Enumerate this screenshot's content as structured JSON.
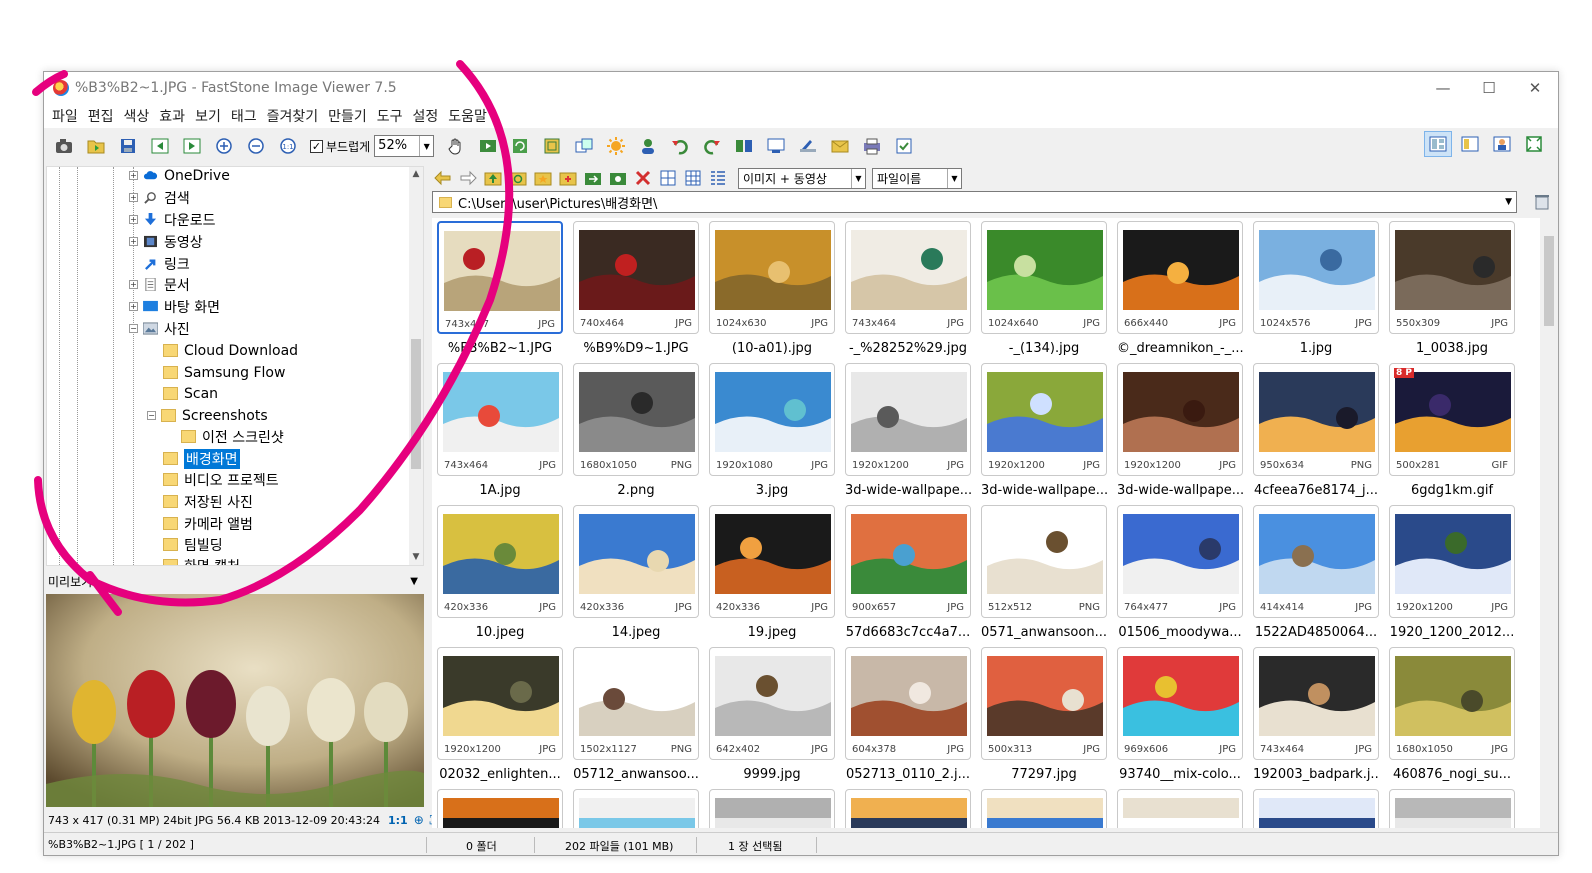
{
  "window": {
    "title": "%B3%B2~1.JPG  -  FastStone Image Viewer 7.5",
    "controls": {
      "minimize": "—",
      "maximize": "☐",
      "close": "✕"
    }
  },
  "menu": [
    "파일",
    "편집",
    "색상",
    "효과",
    "보기",
    "태그",
    "즐겨찾기",
    "만들기",
    "도구",
    "설정",
    "도움말"
  ],
  "toolbar": {
    "smooth_label": "부드럽게",
    "smooth_checked": true,
    "zoom": "52%"
  },
  "tree": {
    "items": [
      {
        "label": "OneDrive",
        "icon": "cloud-icon"
      },
      {
        "label": "검색",
        "icon": "search-icon"
      },
      {
        "label": "다운로드",
        "icon": "download-icon"
      },
      {
        "label": "동영상",
        "icon": "video-icon"
      },
      {
        "label": "링크",
        "icon": "link-icon"
      },
      {
        "label": "문서",
        "icon": "document-icon"
      },
      {
        "label": "바탕 화면",
        "icon": "desktop-icon"
      },
      {
        "label": "사진",
        "icon": "pictures-icon"
      },
      {
        "label": "Cloud Download",
        "icon": "folder-icon"
      },
      {
        "label": "Samsung Flow",
        "icon": "folder-icon"
      },
      {
        "label": "Scan",
        "icon": "folder-icon"
      },
      {
        "label": "Screenshots",
        "icon": "folder-icon"
      },
      {
        "label": "이전 스크린샷",
        "icon": "folder-icon"
      },
      {
        "label": "배경화면",
        "icon": "folder-icon",
        "selected": true
      },
      {
        "label": "비디오 프로젝트",
        "icon": "folder-icon"
      },
      {
        "label": "저장된 사진",
        "icon": "folder-icon"
      },
      {
        "label": "카메라 앨범",
        "icon": "folder-icon"
      },
      {
        "label": "팀빌딩",
        "icon": "folder-icon"
      },
      {
        "label": "화면 캡처",
        "icon": "folder-icon"
      }
    ]
  },
  "preview": {
    "title": "미리보기",
    "info": "743 x 417 (0.31 MP)  24bit  JPG   56.4 KB   2013-12-09 20:43:24",
    "ratio": "1:1"
  },
  "browser": {
    "filter": "이미지 + 동영상",
    "sort": "파일이름",
    "path": "C:\\Users\\user\\Pictures\\배경화면\\",
    "thumbnails": [
      {
        "name": "%B3%B2~1.JPG",
        "dims": "743x417",
        "ext": "JPG",
        "selected": true
      },
      {
        "name": "%B9%D9~1.JPG",
        "dims": "740x464",
        "ext": "JPG"
      },
      {
        "name": "(10-a01).jpg",
        "dims": "1024x630",
        "ext": "JPG"
      },
      {
        "name": "-_%28252%29.jpg",
        "dims": "743x464",
        "ext": "JPG"
      },
      {
        "name": "-_(134).jpg",
        "dims": "1024x640",
        "ext": "JPG"
      },
      {
        "name": "©_dreamnikon_-_...",
        "dims": "666x440",
        "ext": "JPG"
      },
      {
        "name": "1.jpg",
        "dims": "1024x576",
        "ext": "JPG"
      },
      {
        "name": "1_0038.jpg",
        "dims": "550x309",
        "ext": "JPG"
      },
      {
        "name": "1A.jpg",
        "dims": "743x464",
        "ext": "JPG"
      },
      {
        "name": "2.png",
        "dims": "1680x1050",
        "ext": "PNG"
      },
      {
        "name": "3.jpg",
        "dims": "1920x1080",
        "ext": "JPG"
      },
      {
        "name": "3d-wide-wallpape...",
        "dims": "1920x1200",
        "ext": "JPG"
      },
      {
        "name": "3d-wide-wallpape...",
        "dims": "1920x1200",
        "ext": "JPG"
      },
      {
        "name": "3d-wide-wallpape...",
        "dims": "1920x1200",
        "ext": "JPG"
      },
      {
        "name": "4cfeea76e8174_j...",
        "dims": "950x634",
        "ext": "PNG"
      },
      {
        "name": "6gdg1km.gif",
        "dims": "500x281",
        "ext": "GIF",
        "badge": "8 P"
      },
      {
        "name": "10.jpeg",
        "dims": "420x336",
        "ext": "JPG"
      },
      {
        "name": "14.jpeg",
        "dims": "420x336",
        "ext": "JPG"
      },
      {
        "name": "19.jpeg",
        "dims": "420x336",
        "ext": "JPG"
      },
      {
        "name": "57d6683c7cc4a7...",
        "dims": "900x657",
        "ext": "JPG"
      },
      {
        "name": "0571_anwansoon...",
        "dims": "512x512",
        "ext": "PNG"
      },
      {
        "name": "01506_moodywa...",
        "dims": "764x477",
        "ext": "JPG"
      },
      {
        "name": "1522AD4850064...",
        "dims": "414x414",
        "ext": "JPG"
      },
      {
        "name": "1920_1200_2012...",
        "dims": "1920x1200",
        "ext": "JPG"
      },
      {
        "name": "02032_enlighten...",
        "dims": "1920x1200",
        "ext": "JPG"
      },
      {
        "name": "05712_anwansoo...",
        "dims": "1502x1127",
        "ext": "PNG"
      },
      {
        "name": "9999.jpg",
        "dims": "642x402",
        "ext": "JPG"
      },
      {
        "name": "052713_0110_2.j...",
        "dims": "604x378",
        "ext": "JPG"
      },
      {
        "name": "77297.jpg",
        "dims": "500x313",
        "ext": "JPG"
      },
      {
        "name": "93740__mix-colo...",
        "dims": "969x606",
        "ext": "JPG"
      },
      {
        "name": "192003_badpark.j...",
        "dims": "743x464",
        "ext": "JPG"
      },
      {
        "name": "460876_nogi_su...",
        "dims": "1680x1050",
        "ext": "JPG"
      }
    ]
  },
  "status": {
    "file": "%B3%B2~1.JPG [ 1 / 202 ]",
    "folders": "0 폴더",
    "files": "202 파일들 (101 MB)",
    "selected": "1 장 선택됨"
  },
  "colors": {
    "selection": "#0078d7",
    "thumb_selection": "#2a6dd8",
    "annotation": "#e6007e"
  }
}
